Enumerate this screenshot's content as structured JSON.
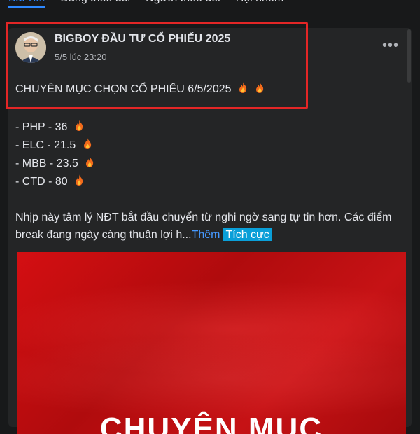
{
  "tabs": [
    {
      "label": "Bài viết",
      "active": true
    },
    {
      "label": "Đang theo dõi",
      "active": false
    },
    {
      "label": "Người theo dõi",
      "active": false
    },
    {
      "label": "Hội nhóm",
      "active": false
    }
  ],
  "post": {
    "author": "BIGBOY ĐẦU TƯ CỔ PHIẾU 2025",
    "time": "5/5 lúc 23:20",
    "headline": "CHUYÊN MỤC CHỌN CỔ PHIẾU 6/5/2025",
    "stocks": [
      "- PHP - 36",
      "- ELC - 21.5",
      "- MBB - 23.5",
      "- CTD - 80"
    ],
    "paragraph": "Nhịp này tâm lý NĐT bắt đầu chuyển từ nghi ngờ sang tự tin hơn. Các điểm break đang ngày càng thuận lợi h...",
    "see_more": "Thêm",
    "tag": "Tích cực",
    "image_title": "CHUYÊN MỤC",
    "more_icon": "more-horizontal-icon"
  },
  "colors": {
    "background": "#18191a",
    "card": "#242526",
    "accent": "#2d88ff",
    "highlight": "#e32626",
    "tag": "#0a9fd8",
    "image_red": "#c61215"
  }
}
